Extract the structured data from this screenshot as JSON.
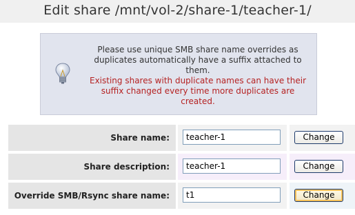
{
  "page": {
    "title": "Edit share /mnt/vol-2/share-1/teacher-1/"
  },
  "notice": {
    "icon": "lightbulb-icon",
    "info_text": "Please use unique SMB share name overrides as duplicates automatically have a suffix attached to them.",
    "warning_text": "Existing shares with duplicate names can have their suffix changed every time more duplicates are created.",
    "warning_color": "#b52222"
  },
  "form": {
    "rows": [
      {
        "label": "Share name:",
        "value": "teacher-1",
        "button": "Change"
      },
      {
        "label": "Share description:",
        "value": "teacher-1",
        "button": "Change"
      },
      {
        "label": "Override SMB/Rsync share name:",
        "value": "t1",
        "button": "Change"
      }
    ]
  }
}
